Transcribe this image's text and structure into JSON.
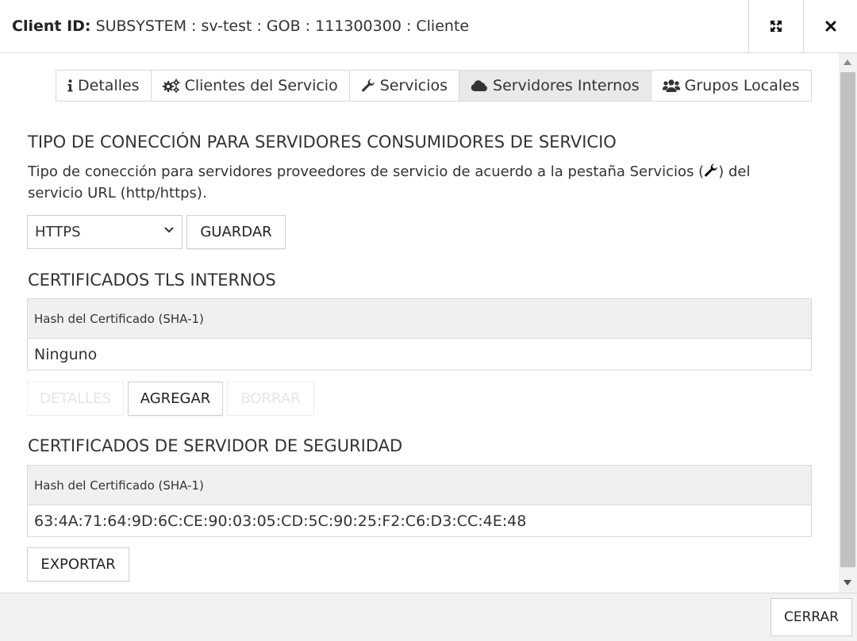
{
  "header": {
    "title_label": "Client ID:",
    "title_value": "SUBSYSTEM : sv-test : GOB : 111300300 : Cliente",
    "expand_icon": "expand-icon",
    "close_icon": "close-icon"
  },
  "tabs": [
    {
      "label": "Detalles",
      "icon": "info-icon",
      "active": false
    },
    {
      "label": "Clientes del Servicio",
      "icon": "gears-icon",
      "active": false
    },
    {
      "label": "Servicios",
      "icon": "wrench-icon",
      "active": false
    },
    {
      "label": "Servidores Internos",
      "icon": "cloud-icon",
      "active": true
    },
    {
      "label": "Grupos Locales",
      "icon": "users-icon",
      "active": false
    }
  ],
  "connection": {
    "title": "TIPO DE CONECCIÓN PARA SERVIDORES CONSUMIDORES DE SERVICIO",
    "desc_before": "Tipo de conección para servidores proveedores de servicio de acuerdo a la pestaña Servicios (",
    "desc_after": ") del servicio URL (http/https).",
    "selected": "HTTPS",
    "save_label": "GUARDAR"
  },
  "tls": {
    "title": "CERTIFICADOS TLS INTERNOS",
    "column": "Hash del Certificado (SHA-1)",
    "rows": [
      "Ninguno"
    ],
    "details_label": "DETALLES",
    "add_label": "AGREGAR",
    "delete_label": "BORRAR"
  },
  "security": {
    "title": "CERTIFICADOS DE SERVIDOR DE SEGURIDAD",
    "column": "Hash del Certificado (SHA-1)",
    "rows": [
      "63:4A:71:64:9D:6C:CE:90:03:05:CD:5C:90:25:F2:C6:D3:CC:4E:48"
    ],
    "export_label": "EXPORTAR"
  },
  "footer": {
    "close_label": "CERRAR"
  }
}
